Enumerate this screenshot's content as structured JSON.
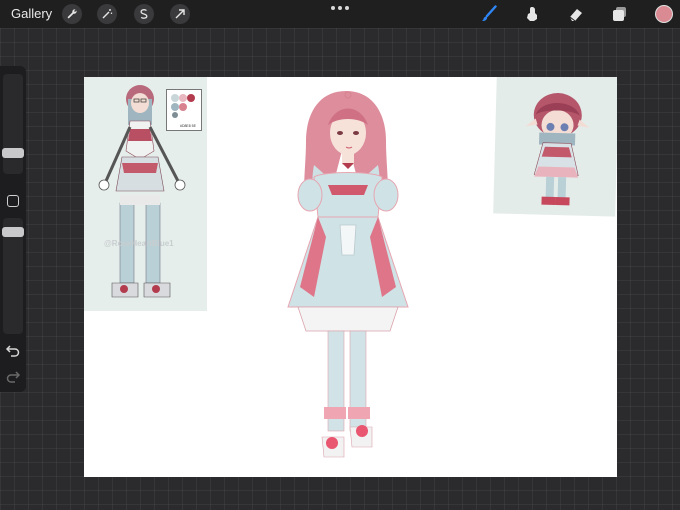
{
  "toolbar": {
    "gallery_label": "Gallery",
    "left_tools": [
      "wrench-icon",
      "magic-wand-icon",
      "selection-icon",
      "transform-arrow-icon"
    ],
    "right_tools": [
      "brush-icon",
      "smudge-icon",
      "eraser-icon",
      "layers-icon"
    ],
    "active_tool": "brush-icon",
    "active_color": "#d98a93"
  },
  "canvas": {
    "background": "#ffffff",
    "watermark": "@RoseHeartBlue1",
    "palette_card_label": "#D8E8 5E"
  },
  "colors": {
    "hair_pink": "#d8818f",
    "dress_mint": "#cfe3e6",
    "accent_red": "#b23b4e",
    "skin": "#f5dfd6",
    "blue_brush": "#2f86f5"
  }
}
